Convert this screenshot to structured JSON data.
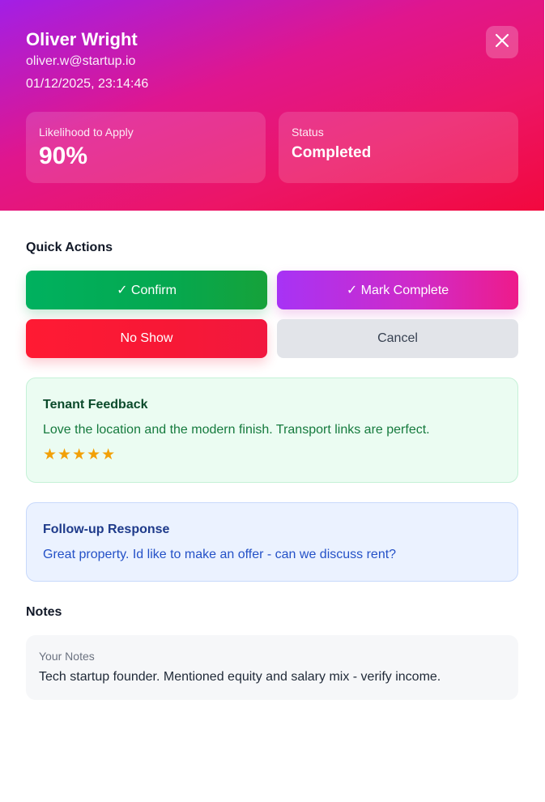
{
  "header": {
    "name": "Oliver Wright",
    "email": "oliver.w@startup.io",
    "datetime": "01/12/2025, 23:14:46",
    "close_icon": "close-icon",
    "stats": {
      "likelihood_label": "Likelihood to Apply",
      "likelihood_value": "90%",
      "status_label": "Status",
      "status_value": "Completed"
    }
  },
  "quick_actions": {
    "title": "Quick Actions",
    "confirm_label": "✓ Confirm",
    "mark_complete_label": "✓ Mark Complete",
    "no_show_label": "No Show",
    "cancel_label": "Cancel"
  },
  "feedback": {
    "title": "Tenant Feedback",
    "text": "Love the location and the modern finish. Transport links are perfect.",
    "rating": 5,
    "rating_max": 5,
    "stars": "★★★★★"
  },
  "followup": {
    "title": "Follow-up Response",
    "text": "Great property. Id like to make an offer - can we discuss rent?"
  },
  "notes": {
    "title": "Notes",
    "label": "Your Notes",
    "text": "Tech startup founder. Mentioned equity and salary mix - verify income."
  },
  "colors": {
    "header_gradient_start": "#a21fe6",
    "header_gradient_end": "#f2083e",
    "confirm": "#05a84f",
    "mark_complete": "#d12ac6",
    "no_show": "#f71836",
    "cancel": "#e2e4e9",
    "star": "#f2a007"
  }
}
